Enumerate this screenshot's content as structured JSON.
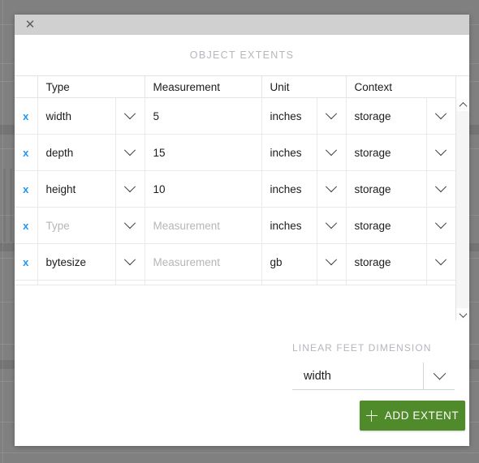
{
  "modal": {
    "close_icon": "close-icon",
    "title": "OBJECT EXTENTS"
  },
  "table": {
    "columns": [
      "",
      "Type",
      "",
      "Measurement",
      "Unit",
      "",
      "Context",
      ""
    ],
    "headers": {
      "type": "Type",
      "measurement": "Measurement",
      "unit": "Unit",
      "context": "Context"
    },
    "placeholders": {
      "type": "Type",
      "measurement": "Measurement"
    },
    "rows": [
      {
        "delete_icon": "x",
        "type": "width",
        "type_is_placeholder": false,
        "measurement": "5",
        "measurement_is_placeholder": false,
        "unit": "inches",
        "context": "storage"
      },
      {
        "delete_icon": "x",
        "type": "depth",
        "type_is_placeholder": false,
        "measurement": "15",
        "measurement_is_placeholder": false,
        "unit": "inches",
        "context": "storage"
      },
      {
        "delete_icon": "x",
        "type": "height",
        "type_is_placeholder": false,
        "measurement": "10",
        "measurement_is_placeholder": false,
        "unit": "inches",
        "context": "storage"
      },
      {
        "delete_icon": "x",
        "type": "Type",
        "type_is_placeholder": true,
        "measurement": "Measurement",
        "measurement_is_placeholder": true,
        "unit": "inches",
        "context": "storage"
      },
      {
        "delete_icon": "x",
        "type": "bytesize",
        "type_is_placeholder": false,
        "measurement": "Measurement",
        "measurement_is_placeholder": true,
        "unit": "gb",
        "context": "storage"
      }
    ]
  },
  "scrollbar": {
    "up_icon": "chevron-up-icon",
    "down_icon": "chevron-down-icon"
  },
  "footer": {
    "linear_feet_label": "LINEAR FEET DIMENSION",
    "linear_feet_value": "width",
    "add_extent_label": "ADD EXTENT",
    "add_icon": "plus-icon"
  },
  "colors": {
    "accent_green": "#4f8a2b",
    "delete_blue": "#2196f3",
    "label_gray": "#b6b6be",
    "titlebar_gray": "#d0d0d0",
    "backdrop_gray": "#808080"
  }
}
